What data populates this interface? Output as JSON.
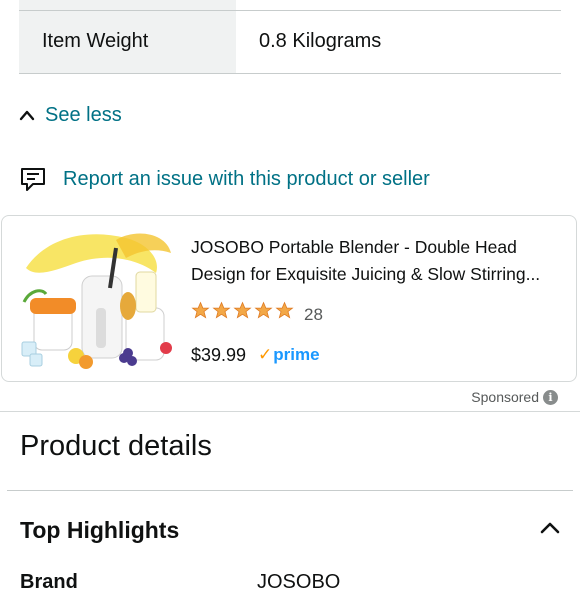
{
  "spec_table": {
    "rows": [
      {
        "label": "Item Weight",
        "value": "0.8 Kilograms"
      }
    ]
  },
  "see_less": {
    "label": "See less",
    "icon": "chevron-up-icon"
  },
  "report": {
    "label": "Report an issue with this product or seller",
    "icon": "report-flag-icon"
  },
  "sponsored_product": {
    "title_line1": "JOSOBO Portable Blender - Double Head",
    "title_line2": "Design for Exquisite Juicing & Slow Stirring...",
    "rating_stars": 5,
    "rating_count": "28",
    "price": "$39.99",
    "prime_label": "prime",
    "star_color": "#f3a847"
  },
  "sponsored_label": "Sponsored",
  "product_details": {
    "heading": "Product details",
    "section_heading": "Top Highlights",
    "partial_row_label": "Brand",
    "partial_row_value": "JOSOBO"
  },
  "colors": {
    "link": "#007185",
    "prime_blue": "#1a98ff",
    "prime_check": "#ff9900",
    "table_shade": "#f0f2f2"
  }
}
